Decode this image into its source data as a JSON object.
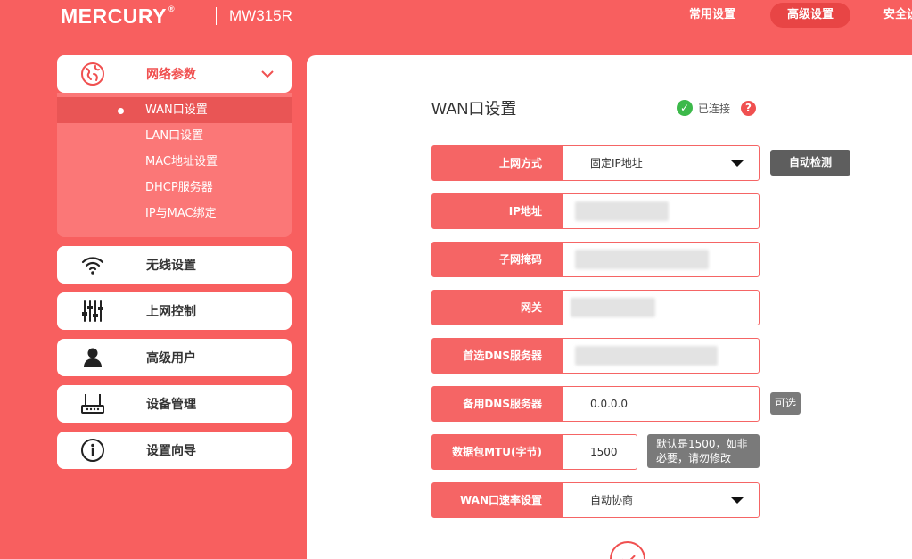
{
  "header": {
    "brand": "MERCURY",
    "brand_mark": "®",
    "model": "MW315R",
    "nav": [
      {
        "label": "常用设置",
        "active": false
      },
      {
        "label": "高级设置",
        "active": true
      },
      {
        "label": "安全设",
        "active": false
      }
    ]
  },
  "sidebar": {
    "network": {
      "label": "网络参数",
      "icon": "globe-icon",
      "expanded": true,
      "items": [
        {
          "label": "WAN口设置",
          "active": true
        },
        {
          "label": "LAN口设置",
          "active": false
        },
        {
          "label": "MAC地址设置",
          "active": false
        },
        {
          "label": "DHCP服务器",
          "active": false
        },
        {
          "label": "IP与MAC绑定",
          "active": false
        }
      ]
    },
    "menu": [
      {
        "label": "无线设置",
        "icon": "wifi-icon"
      },
      {
        "label": "上网控制",
        "icon": "sliders-icon"
      },
      {
        "label": "高级用户",
        "icon": "user-icon"
      },
      {
        "label": "设备管理",
        "icon": "router-icon"
      },
      {
        "label": "设置向导",
        "icon": "info-icon"
      }
    ]
  },
  "main": {
    "title": "WAN口设置",
    "status": "已连接",
    "help": "?",
    "fields": {
      "conn_type": {
        "label": "上网方式",
        "value": "固定IP地址"
      },
      "ip": {
        "label": "IP地址",
        "value": ""
      },
      "mask": {
        "label": "子网掩码",
        "value": ""
      },
      "gateway": {
        "label": "网关",
        "value": ""
      },
      "dns1": {
        "label": "首选DNS服务器",
        "value": ""
      },
      "dns2": {
        "label": "备用DNS服务器",
        "value": "0.0.0.0"
      },
      "mtu": {
        "label": "数据包MTU(字节)",
        "value": "1500"
      },
      "speed": {
        "label": "WAN口速率设置",
        "value": "自动协商"
      }
    },
    "detect_button": "自动检测",
    "optional_tag": "可选",
    "mtu_tip_line1": "默认是1500，如非",
    "mtu_tip_line2": "必要，请勿修改"
  },
  "colors": {
    "primary": "#f85f5f",
    "field_label": "#f56565",
    "active_sub": "#e95555",
    "success": "#3cb94a",
    "gray_button": "#5e5e5e"
  }
}
